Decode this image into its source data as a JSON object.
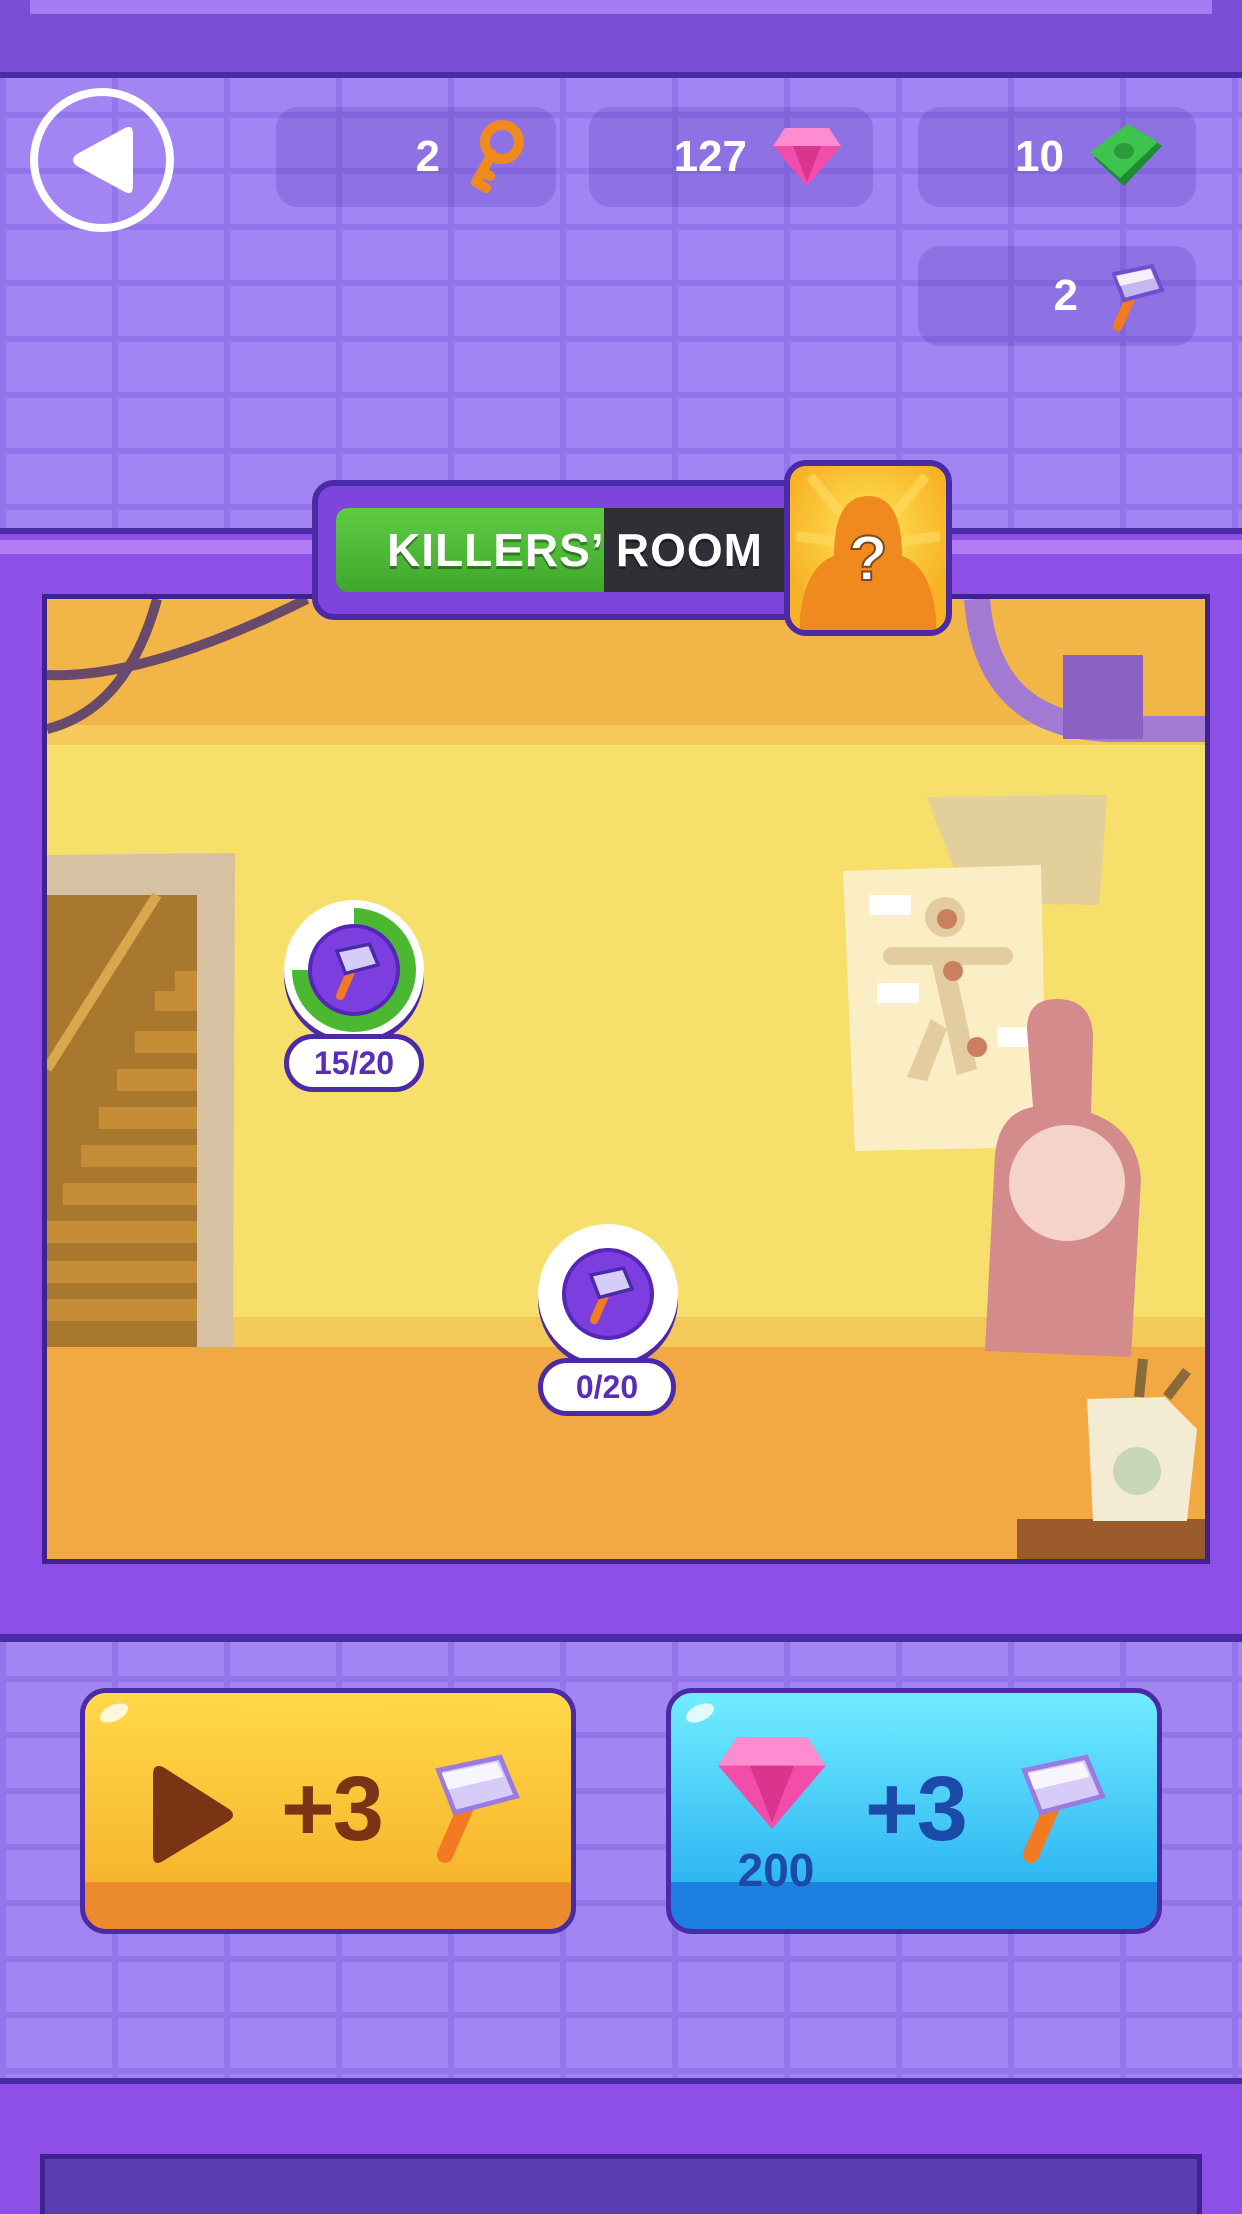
{
  "resources": {
    "keys": "2",
    "gems": "127",
    "cash": "10",
    "hammers": "2"
  },
  "room": {
    "title": "KILLERS’ ROOM",
    "progress_fraction": 0.56,
    "mystery_symbol": "?"
  },
  "hotspots": [
    {
      "count": "15/20",
      "progress": 0.75
    },
    {
      "count": "0/20",
      "progress": 0
    }
  ],
  "actions": {
    "watch_ad": {
      "reward": "+3"
    },
    "buy_gems": {
      "reward": "+3",
      "price": "200"
    }
  },
  "colors": {
    "accent_purple": "#8d4fe6",
    "progress_green": "#4cb832",
    "ad_button": "#f7b52c",
    "gem_button": "#2fb7f3"
  },
  "icons": [
    "back-arrow-icon",
    "key-icon",
    "gem-icon",
    "cash-icon",
    "hammer-icon",
    "play-icon",
    "silhouette-icon"
  ]
}
